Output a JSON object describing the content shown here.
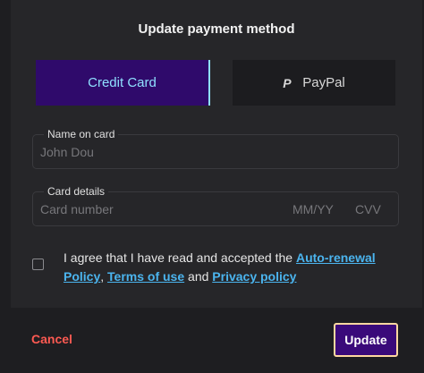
{
  "dialog": {
    "title": "Update payment method"
  },
  "tabs": {
    "credit_card": "Credit Card",
    "paypal": "PayPal",
    "paypal_icon": "paypal-icon"
  },
  "fields": {
    "name": {
      "legend": "Name on card",
      "placeholder": "John Dou"
    },
    "card": {
      "legend": "Card details",
      "number_placeholder": "Card number",
      "expiry_placeholder": "MM/YY",
      "cvv_placeholder": "CVV"
    }
  },
  "agreement": {
    "prefix": "I agree that I have read and accepted the ",
    "link_autorenewal": "Auto-renewal Policy",
    "sep1": ", ",
    "link_terms": "Terms of use",
    "sep2": " and ",
    "link_privacy": "Privacy policy",
    "checked": false
  },
  "footer": {
    "cancel_label": "Cancel",
    "update_label": "Update"
  },
  "colors": {
    "accent_purple": "#2f0a6b",
    "tab_text": "#8fe0ff",
    "link": "#4bb4ee",
    "cancel": "#ff5a52",
    "update_border": "#ffd8a0"
  }
}
